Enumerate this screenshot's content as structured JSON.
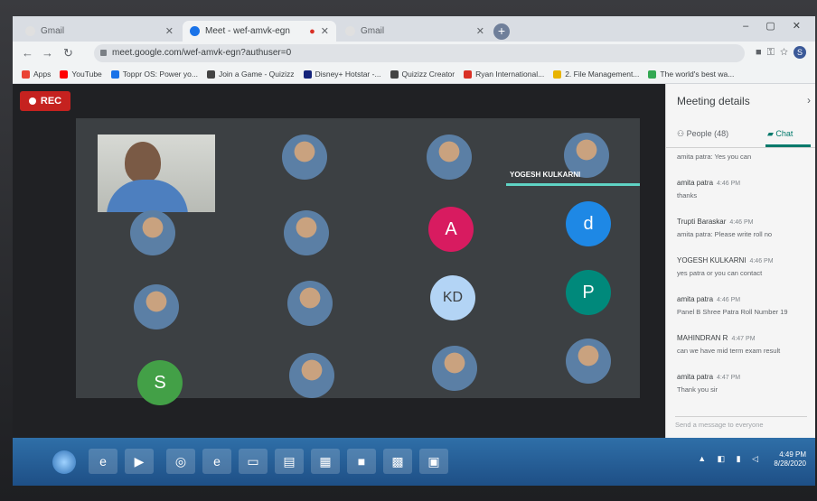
{
  "tabs": [
    {
      "title": "Gmail",
      "icon": "gmail-icon",
      "color": "#e0e0e0"
    },
    {
      "title": "Meet - wef-amvk-egn",
      "icon": "meet-icon",
      "color": "#1a73e8"
    },
    {
      "title": "Gmail",
      "icon": "gmail-icon",
      "color": "#e0e0e0"
    }
  ],
  "address": {
    "url": "meet.google.com/wef-amvk-egn?authuser=0"
  },
  "bookmarks": [
    {
      "label": "Apps",
      "color": "#ea4335"
    },
    {
      "label": "YouTube",
      "color": "#ff0000"
    },
    {
      "label": "Toppr OS: Power yo...",
      "color": "#1a73e8"
    },
    {
      "label": "Join a Game - Quizizz",
      "color": "#444444"
    },
    {
      "label": "Disney+ Hotstar -...",
      "color": "#14237a"
    },
    {
      "label": "Quizizz Creator",
      "color": "#444444"
    },
    {
      "label": "Ryan International...",
      "color": "#d93025"
    },
    {
      "label": "2. File Management...",
      "color": "#e8b400"
    },
    {
      "label": "The world's best wa...",
      "color": "#34a853"
    }
  ],
  "meet": {
    "rec_label": "REC",
    "speaker_name": "YOGESH KULKARNI",
    "participants": [
      {
        "initial": "",
        "kind": "video"
      },
      {
        "initial": "",
        "kind": "photo"
      },
      {
        "initial": "",
        "kind": "photo"
      },
      {
        "initial": "",
        "kind": "photo"
      },
      {
        "initial": "",
        "kind": "photo"
      },
      {
        "initial": "",
        "kind": "photo"
      },
      {
        "initial": "A",
        "kind": "letter",
        "color": "#d81b60"
      },
      {
        "initial": "d",
        "kind": "letter",
        "color": "#1e88e5"
      },
      {
        "initial": "",
        "kind": "photo"
      },
      {
        "initial": "",
        "kind": "photo"
      },
      {
        "initial": "KD",
        "kind": "letter",
        "color": "#b3d4f5",
        "text_color": "#3c4043"
      },
      {
        "initial": "P",
        "kind": "letter",
        "color": "#00897b"
      },
      {
        "initial": "S",
        "kind": "letter",
        "color": "#43a047"
      },
      {
        "initial": "",
        "kind": "photo"
      },
      {
        "initial": "",
        "kind": "photo"
      },
      {
        "initial": "",
        "kind": "photo"
      }
    ]
  },
  "panel": {
    "title": "Meeting details",
    "people_tab": "People (48)",
    "chat_tab": "Chat",
    "messages": [
      {
        "who": "",
        "time": "",
        "text": "amita patra: Yes you can"
      },
      {
        "who": "amita patra",
        "time": "4:46 PM",
        "text": "thanks"
      },
      {
        "who": "Trupti Baraskar",
        "time": "4:46 PM",
        "text": "amita patra: Please write roll no"
      },
      {
        "who": "YOGESH KULKARNI",
        "time": "4:46 PM",
        "text": "yes patra or you can contact"
      },
      {
        "who": "amita patra",
        "time": "4:46 PM",
        "text": "Panel B Shree Patra Roll Number 19"
      },
      {
        "who": "MAHINDRAN R",
        "time": "4:47 PM",
        "text": "can we have mid term exam result"
      },
      {
        "who": "amita patra",
        "time": "4:47 PM",
        "text": "Thank you sir"
      }
    ],
    "send_placeholder": "Send a message to everyone"
  },
  "taskbar": {
    "apps": [
      "ie-icon",
      "media-icon",
      "chrome-icon",
      "edge-icon",
      "folder-icon",
      "explorer-icon",
      "store-icon",
      "video-icon",
      "excel-icon",
      "slides-icon"
    ],
    "time": "4:49 PM",
    "date": "8/28/2020"
  }
}
